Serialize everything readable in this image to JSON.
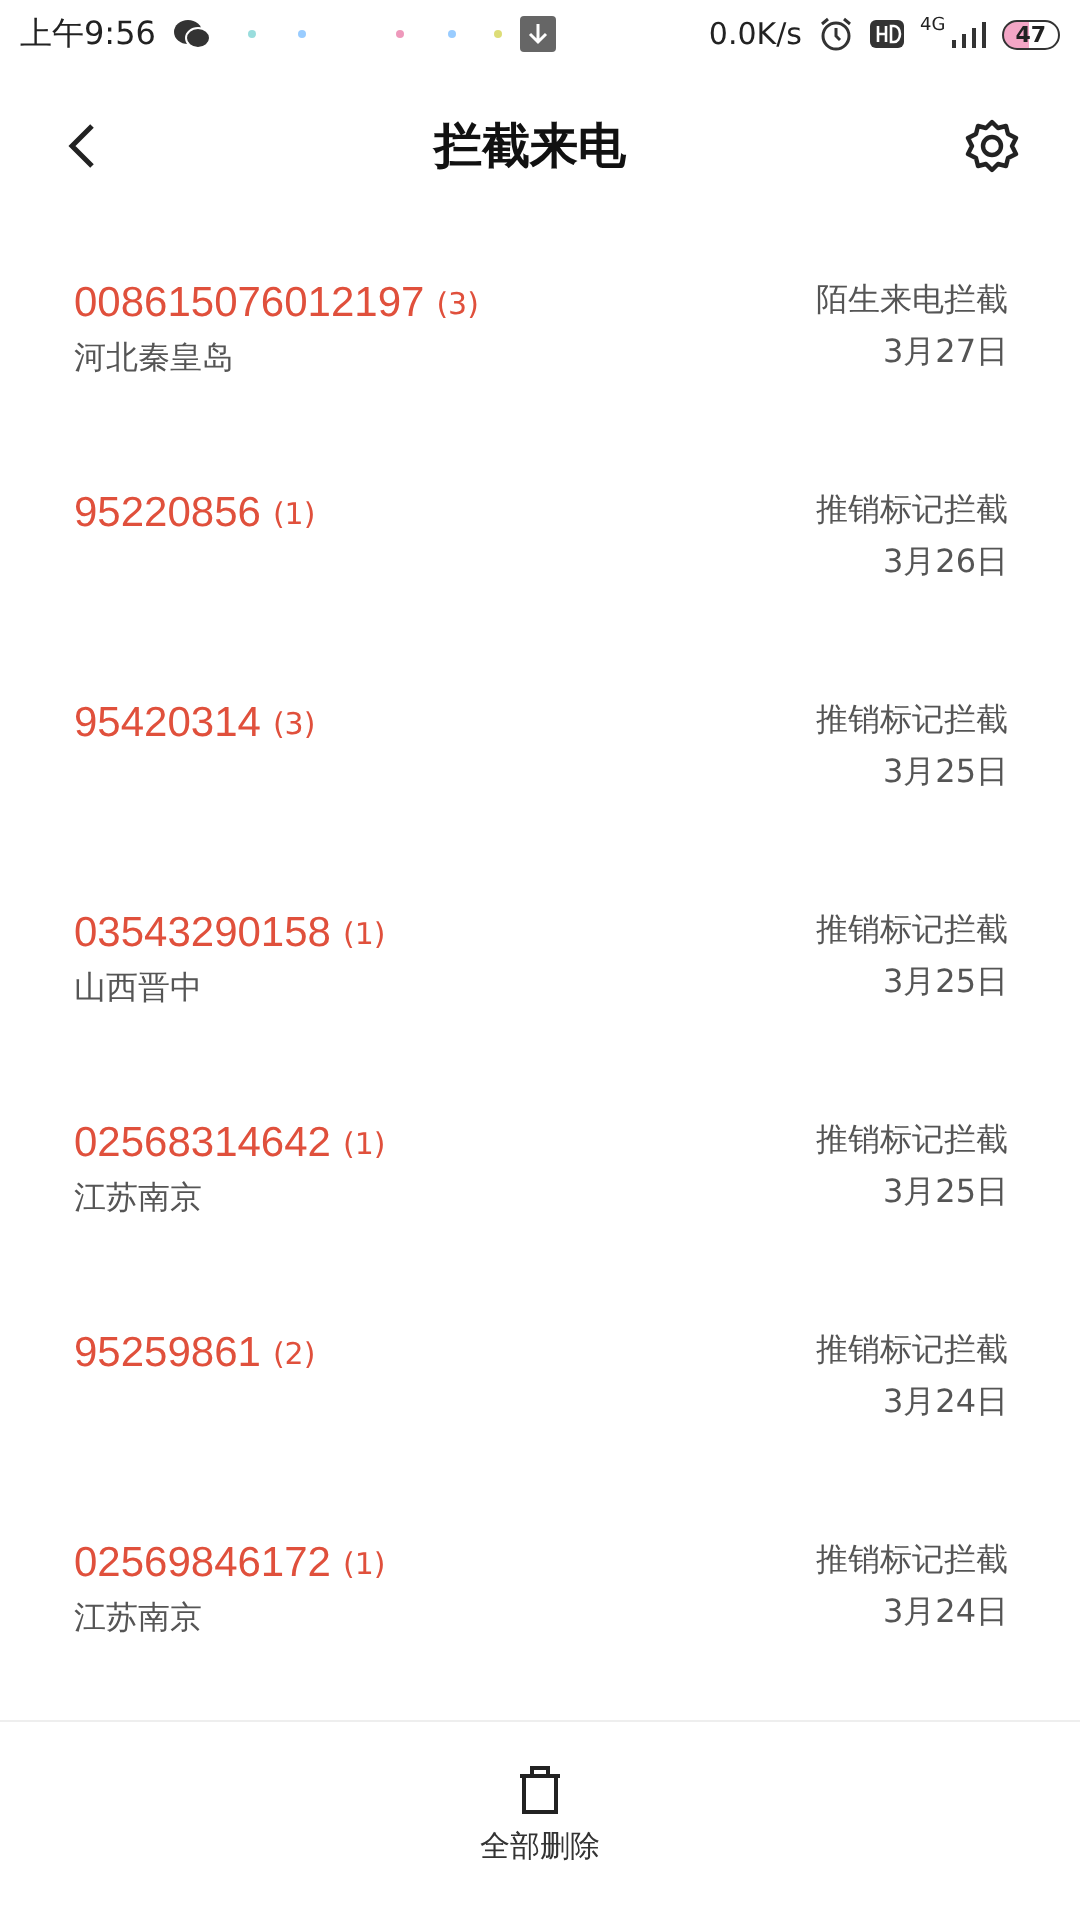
{
  "status_bar": {
    "time": "上午9:56",
    "speed": "0.0K/s",
    "network": "4G",
    "battery": "47"
  },
  "header": {
    "title": "拦截来电"
  },
  "calls": [
    {
      "number": "008615076012197",
      "count": "(3)",
      "location": "河北秦皇岛",
      "reason": "陌生来电拦截",
      "date": "3月27日"
    },
    {
      "number": "95220856",
      "count": "(1)",
      "reason": "推销标记拦截",
      "date": "3月26日"
    },
    {
      "number": "95420314",
      "count": "(3)",
      "reason": "推销标记拦截",
      "date": "3月25日"
    },
    {
      "number": "03543290158",
      "count": "(1)",
      "location": "山西晋中",
      "reason": "推销标记拦截",
      "date": "3月25日"
    },
    {
      "number": "02568314642",
      "count": "(1)",
      "location": "江苏南京",
      "reason": "推销标记拦截",
      "date": "3月25日"
    },
    {
      "number": "95259861",
      "count": "(2)",
      "reason": "推销标记拦截",
      "date": "3月24日"
    },
    {
      "number": "02569846172",
      "count": "(1)",
      "location": "江苏南京",
      "reason": "推销标记拦截",
      "date": "3月24日"
    }
  ],
  "footer": {
    "delete_all": "全部删除"
  }
}
